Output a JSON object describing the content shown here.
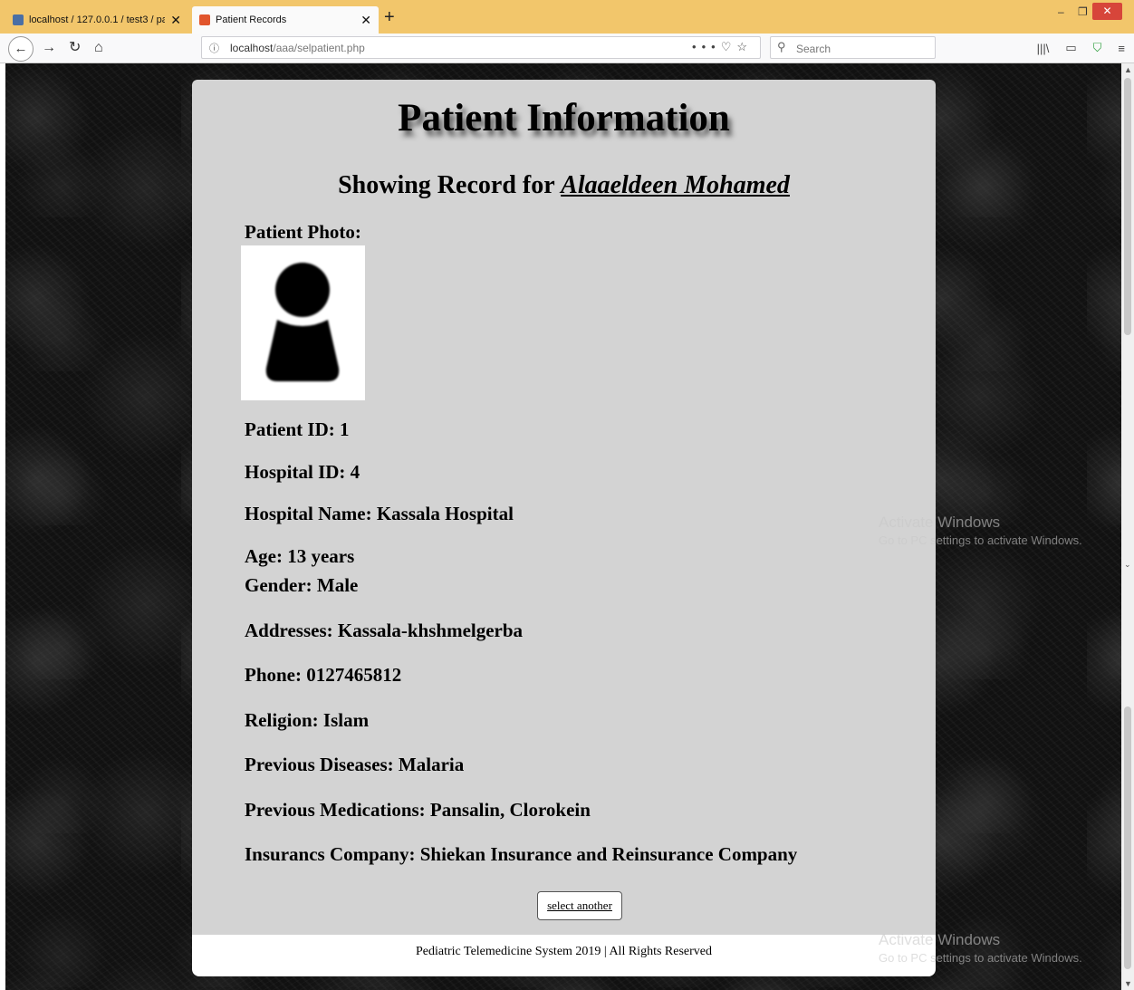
{
  "browser": {
    "tabs": [
      {
        "title": "localhost / 127.0.0.1 / test3 / pa",
        "favicon": "phpmyadmin-icon",
        "active": false
      },
      {
        "title": "Patient Records",
        "favicon": "xampp-icon",
        "active": true
      }
    ],
    "new_tab": "+",
    "url": {
      "host": "localhost",
      "path": "/aaa/selpatient.php"
    },
    "search_placeholder": "Search"
  },
  "page": {
    "title": "Patient Information",
    "subtitle_prefix": "Showing Record for ",
    "patient_name": "Alaaeldeen Mohamed",
    "photo_label": "Patient Photo:",
    "fields": {
      "patient_id": "Patient ID: 1",
      "hospital_id": "Hospital ID: 4",
      "hospital_name": "Hospital Name: Kassala Hospital",
      "age": "Age: 13 years",
      "gender": "Gender: Male",
      "address": "Addresses: Kassala-khshmelgerba",
      "phone": "Phone: 0127465812",
      "religion": "Religion: Islam",
      "previous_diseases": "Previous Diseases: Malaria",
      "previous_medications": "Previous Medications: Pansalin, Clorokein",
      "insurance": "Insurancs Company: Shiekan Insurance and Reinsurance Company"
    },
    "select_another": "select another",
    "footer": "Pediatric Telemedicine System 2019 | All Rights Reserved"
  },
  "watermark": {
    "line1": "Activate Windows",
    "line2": "Go to PC settings to activate Windows."
  },
  "colors": {
    "tab_bar": "#f2c66b",
    "card": "#d3d3d3",
    "close_button": "#d7453a"
  }
}
